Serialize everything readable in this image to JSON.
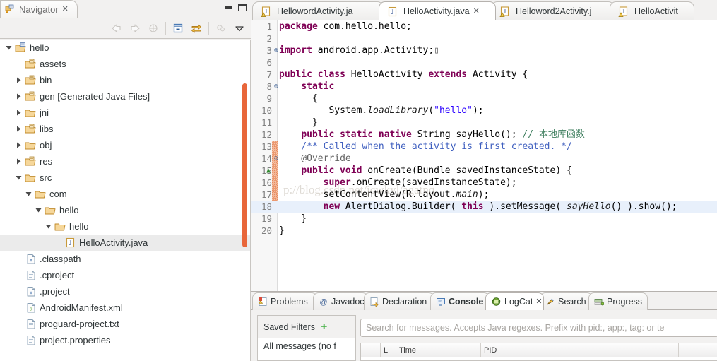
{
  "navigator": {
    "tab_title": "Navigator",
    "close_label": "✕",
    "toolbar": [
      {
        "name": "back-icon",
        "enabled": false
      },
      {
        "name": "forward-icon",
        "enabled": false
      },
      {
        "name": "home-icon",
        "enabled": false
      },
      {
        "name": "collapse-all-icon",
        "enabled": true
      },
      {
        "name": "link-with-editor-icon",
        "enabled": true
      },
      {
        "name": "view-menu-icon",
        "enabled": true
      }
    ],
    "tree": [
      {
        "label": "hello",
        "depth": 0,
        "icon": "project-folder",
        "twisty": "open"
      },
      {
        "label": "assets",
        "depth": 1,
        "icon": "src-folder",
        "twisty": "none"
      },
      {
        "label": "bin",
        "depth": 1,
        "icon": "src-folder",
        "twisty": "closed"
      },
      {
        "label": "gen [Generated Java Files]",
        "depth": 1,
        "icon": "src-folder",
        "twisty": "closed"
      },
      {
        "label": "jni",
        "depth": 1,
        "icon": "folder",
        "twisty": "closed"
      },
      {
        "label": "libs",
        "depth": 1,
        "icon": "src-folder",
        "twisty": "closed"
      },
      {
        "label": "obj",
        "depth": 1,
        "icon": "folder",
        "twisty": "closed"
      },
      {
        "label": "res",
        "depth": 1,
        "icon": "src-folder",
        "twisty": "closed"
      },
      {
        "label": "src",
        "depth": 1,
        "icon": "folder",
        "twisty": "open"
      },
      {
        "label": "com",
        "depth": 2,
        "icon": "folder",
        "twisty": "open"
      },
      {
        "label": "hello",
        "depth": 3,
        "icon": "folder",
        "twisty": "open"
      },
      {
        "label": "hello",
        "depth": 4,
        "icon": "folder",
        "twisty": "open"
      },
      {
        "label": "HelloActivity.java",
        "depth": 5,
        "icon": "java-file",
        "twisty": "none",
        "selected": true
      },
      {
        "label": ".classpath",
        "depth": 1,
        "icon": "xml-file",
        "twisty": "none"
      },
      {
        "label": ".cproject",
        "depth": 1,
        "icon": "text-file",
        "twisty": "none"
      },
      {
        "label": ".project",
        "depth": 1,
        "icon": "xml-file",
        "twisty": "none"
      },
      {
        "label": "AndroidManifest.xml",
        "depth": 1,
        "icon": "android-xml-file",
        "twisty": "none"
      },
      {
        "label": "proguard-project.txt",
        "depth": 1,
        "icon": "text-file",
        "twisty": "none"
      },
      {
        "label": "project.properties",
        "depth": 1,
        "icon": "text-file",
        "twisty": "none"
      }
    ]
  },
  "editor": {
    "tabs": [
      {
        "label": "HellowordActivity.ja",
        "active": false,
        "icon": "java-warning-file"
      },
      {
        "label": "HelloActivity.java",
        "active": true,
        "icon": "java-file",
        "close": "✕"
      },
      {
        "label": "Helloword2Activity.j",
        "active": false,
        "icon": "java-warning-file"
      },
      {
        "label": "HelloActivit",
        "active": false,
        "icon": "java-warning-file"
      }
    ],
    "watermark": "p://blog.csdn.net/jcwkyl/agatnq",
    "lines": [
      {
        "num": "1",
        "fold": "",
        "change": false,
        "tokens": [
          {
            "t": "package",
            "c": "kw"
          },
          {
            "t": " com.hello.hello;",
            "c": "plain"
          }
        ]
      },
      {
        "num": "2",
        "fold": "",
        "change": false,
        "tokens": []
      },
      {
        "num": "3",
        "fold": "+",
        "change": false,
        "tokens": [
          {
            "t": "import",
            "c": "kw"
          },
          {
            "t": " android.app.Activity;",
            "c": "plain"
          },
          {
            "t": "▯",
            "c": "ann"
          }
        ]
      },
      {
        "num": "6",
        "fold": "",
        "change": false,
        "tokens": []
      },
      {
        "num": "7",
        "fold": "",
        "change": false,
        "tokens": [
          {
            "t": "public class",
            "c": "kw"
          },
          {
            "t": " HelloActivity ",
            "c": "plain"
          },
          {
            "t": "extends",
            "c": "kw"
          },
          {
            "t": " Activity {",
            "c": "plain"
          }
        ]
      },
      {
        "num": "8",
        "fold": "−",
        "change": false,
        "tokens": [
          {
            "t": "    ",
            "c": "plain"
          },
          {
            "t": "static",
            "c": "kw"
          }
        ]
      },
      {
        "num": "9",
        "fold": "",
        "change": false,
        "tokens": [
          {
            "t": "      {",
            "c": "plain"
          }
        ]
      },
      {
        "num": "10",
        "fold": "",
        "change": false,
        "tokens": [
          {
            "t": "         System.",
            "c": "plain"
          },
          {
            "t": "loadLibrary",
            "c": "ital"
          },
          {
            "t": "(",
            "c": "plain"
          },
          {
            "t": "\"hello\"",
            "c": "str"
          },
          {
            "t": ");",
            "c": "plain"
          }
        ]
      },
      {
        "num": "11",
        "fold": "",
        "change": false,
        "tokens": [
          {
            "t": "      }",
            "c": "plain"
          }
        ]
      },
      {
        "num": "12",
        "fold": "",
        "change": false,
        "tokens": [
          {
            "t": "    ",
            "c": "plain"
          },
          {
            "t": "public static native",
            "c": "kw"
          },
          {
            "t": " String sayHello(); ",
            "c": "plain"
          },
          {
            "t": "// 本地库函数",
            "c": "cmt"
          }
        ]
      },
      {
        "num": "13",
        "fold": "",
        "change": true,
        "tokens": [
          {
            "t": "    /** Called when the activity is first created. */",
            "c": "doc"
          }
        ]
      },
      {
        "num": "14",
        "fold": "−",
        "change": true,
        "tokens": [
          {
            "t": "    @Override",
            "c": "ann"
          }
        ]
      },
      {
        "num": "15",
        "fold": "",
        "change": true,
        "override": true,
        "tokens": [
          {
            "t": "    ",
            "c": "plain"
          },
          {
            "t": "public void",
            "c": "kw"
          },
          {
            "t": " onCreate(Bundle savedInstanceState) {",
            "c": "plain"
          }
        ]
      },
      {
        "num": "16",
        "fold": "",
        "change": true,
        "tokens": [
          {
            "t": "        ",
            "c": "plain"
          },
          {
            "t": "super",
            "c": "kw"
          },
          {
            "t": ".onCreate(savedInstanceState);",
            "c": "plain"
          }
        ]
      },
      {
        "num": "17",
        "fold": "",
        "change": true,
        "tokens": [
          {
            "t": "        setContentView(R.layout.",
            "c": "plain"
          },
          {
            "t": "main",
            "c": "ital"
          },
          {
            "t": ");",
            "c": "plain"
          }
        ]
      },
      {
        "num": "18",
        "fold": "",
        "change": true,
        "current": true,
        "tokens": [
          {
            "t": "        ",
            "c": "plain"
          },
          {
            "t": "new",
            "c": "kw"
          },
          {
            "t": " AlertDialog.Builder( ",
            "c": "plain"
          },
          {
            "t": "this",
            "c": "kw"
          },
          {
            "t": " ).setMessage( ",
            "c": "plain"
          },
          {
            "t": "sayHello",
            "c": "ital"
          },
          {
            "t": "() ).show();",
            "c": "plain"
          }
        ]
      },
      {
        "num": "19",
        "fold": "",
        "change": false,
        "tokens": [
          {
            "t": "    }",
            "c": "plain"
          }
        ]
      },
      {
        "num": "20",
        "fold": "",
        "change": false,
        "tokens": [
          {
            "t": "}",
            "c": "plain"
          }
        ]
      }
    ]
  },
  "bottom": {
    "tabs": [
      {
        "label": "Problems",
        "icon": "problems-icon",
        "active": false,
        "bold": false
      },
      {
        "label": "Javadoc",
        "icon": "javadoc-icon",
        "active": false,
        "bold": false
      },
      {
        "label": "Declaration",
        "icon": "declaration-icon",
        "active": false,
        "bold": false
      },
      {
        "label": "Console",
        "icon": "console-icon",
        "active": false,
        "bold": true
      },
      {
        "label": "LogCat",
        "icon": "logcat-icon",
        "active": true,
        "bold": false,
        "close": "✕"
      },
      {
        "label": "Search",
        "icon": "search-icon",
        "active": false,
        "bold": false
      },
      {
        "label": "Progress",
        "icon": "progress-icon",
        "active": false,
        "bold": false
      }
    ],
    "logcat": {
      "saved_filters_label": "Saved Filters",
      "add_filter_icon": "+",
      "filter_rows": [
        "All messages (no f"
      ],
      "search_placeholder": "Search for messages. Accepts Java regexes. Prefix with pid:, app:, tag: or te",
      "columns": [
        "",
        "L",
        "Time",
        "",
        "PID",
        ""
      ]
    }
  }
}
